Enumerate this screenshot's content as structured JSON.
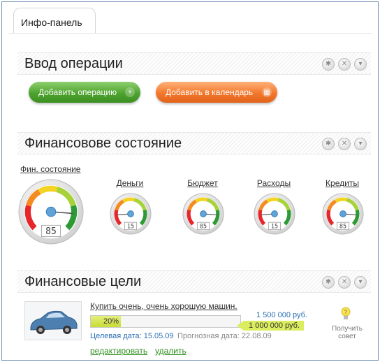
{
  "tab": {
    "label": "Инфо-панель"
  },
  "sections": {
    "operations": {
      "title": "Ввод операции"
    },
    "financial_state": {
      "title": "Финансовове состояние"
    },
    "goals": {
      "title": "Финансовые цели"
    }
  },
  "buttons": {
    "add_operation": "Добавить операцию",
    "add_calendar": "Добавить в календарь"
  },
  "section_controls": [
    "gear-icon",
    "close-icon",
    "chevron-down-icon"
  ],
  "gauges": {
    "main": {
      "label": "Фин. состояние",
      "value": 85
    },
    "items": [
      {
        "label": "Деньги",
        "value": 15
      },
      {
        "label": "Бюджет",
        "value": 85
      },
      {
        "label": "Расходы",
        "value": 15
      },
      {
        "label": "Кредиты",
        "value": 85
      }
    ]
  },
  "goal": {
    "title": "Купить очень, очень хорошую машин.",
    "progress_percent": 20,
    "progress_label": "20%",
    "target_amount": "1 500 000 руб.",
    "current_amount": "1 000 000 руб.",
    "target_date": "Целевая дата: 15.05.09",
    "forecast_date": "Прогнозная дата: 22.08.09",
    "edit": "редактировать",
    "delete": "удалить",
    "advice": "Получить совет"
  },
  "colors": {
    "green_button": "#4ea32f",
    "orange_button": "#f2782d",
    "progress_fill": "#c9dc36",
    "link_green": "#2e8f1e",
    "date_blue": "#2a6fb3"
  }
}
